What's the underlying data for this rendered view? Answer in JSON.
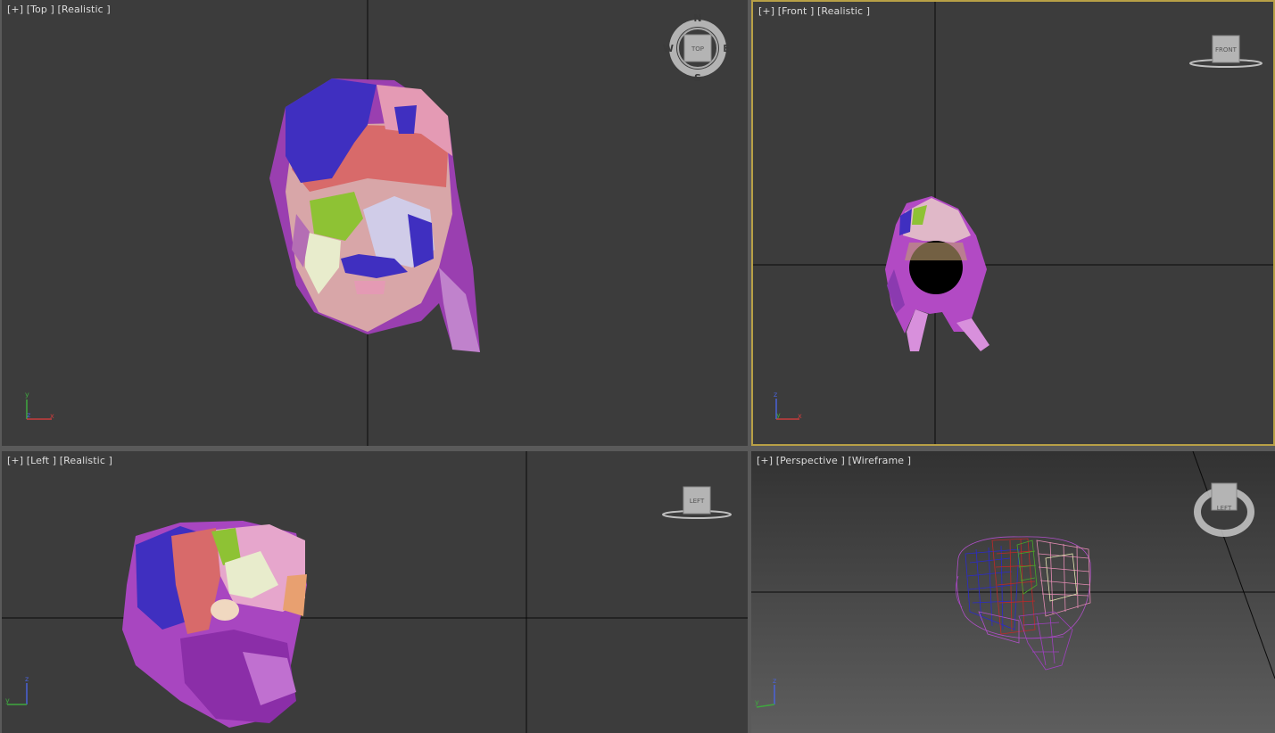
{
  "viewports": {
    "top": {
      "label": "[+] [Top ] [Realistic ]",
      "cube": "TOP",
      "axes": [
        "y",
        "z",
        "x"
      ],
      "compass": [
        "N",
        "E",
        "S",
        "W"
      ]
    },
    "front": {
      "label": "[+] [Front ] [Realistic ]",
      "cube": "FRONT",
      "axes": [
        "z",
        "y",
        "x"
      ],
      "active": true
    },
    "left": {
      "label": "[+] [Left ] [Realistic ]",
      "cube": "LEFT",
      "axes": [
        "z",
        "y"
      ]
    },
    "perspective": {
      "label": "[+] [Perspective ] [Wireframe ]",
      "cube": "LEFT",
      "axes": [
        "z",
        "y"
      ]
    }
  },
  "colors": {
    "viewport_bg": "#3c3c3c",
    "active_border": "#b8a046",
    "grid_line": "#0a0a0a",
    "label_text": "#dcdcdc"
  }
}
